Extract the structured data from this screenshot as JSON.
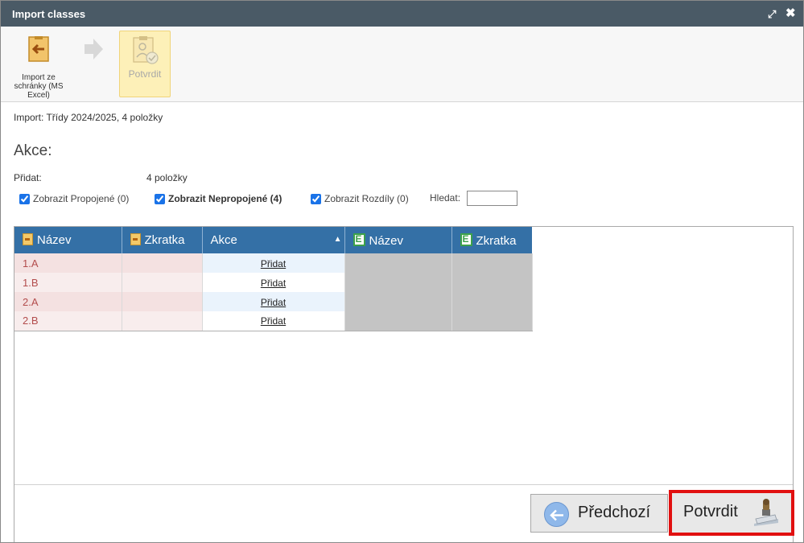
{
  "window": {
    "title": "Import classes"
  },
  "toolbar": {
    "import_label": "Import ze schránky (MS Excel)",
    "confirm_label": "Potvrdit"
  },
  "info_text": "Import: Třídy 2024/2025, 4 položky",
  "section_heading": "Akce:",
  "summary": {
    "add_label": "Přidat:",
    "add_count": "4 položky"
  },
  "filters": {
    "show_linked": "Zobrazit Propojené (0)",
    "show_unlinked": "Zobrazit Nepropojené (4)",
    "show_diffs": "Zobrazit Rozdíly (0)",
    "search_label": "Hledat:",
    "search_value": ""
  },
  "grid": {
    "columns": [
      "Název",
      "Zkratka",
      "Akce",
      "Název",
      "Zkratka"
    ],
    "rows": [
      {
        "name": "1.A",
        "abbr": "",
        "action": "Přidat"
      },
      {
        "name": "1.B",
        "abbr": "",
        "action": "Přidat"
      },
      {
        "name": "2.A",
        "abbr": "",
        "action": "Přidat"
      },
      {
        "name": "2.B",
        "abbr": "",
        "action": "Přidat"
      }
    ]
  },
  "buttons": {
    "previous": "Předchozí",
    "confirm": "Potvrdit"
  },
  "colors": {
    "titlebar": "#4a5a66",
    "grid_header": "#3470a6",
    "highlight_border": "#e11010",
    "toolbar_active": "#fdf0b8"
  },
  "icons": {
    "import": "clipboard-import-icon",
    "next": "arrow-right-icon",
    "confirm": "stamp-icon",
    "source_column": "source-import-icon",
    "target_column": "edookit-e-icon",
    "previous": "arrow-left-circle-icon"
  }
}
